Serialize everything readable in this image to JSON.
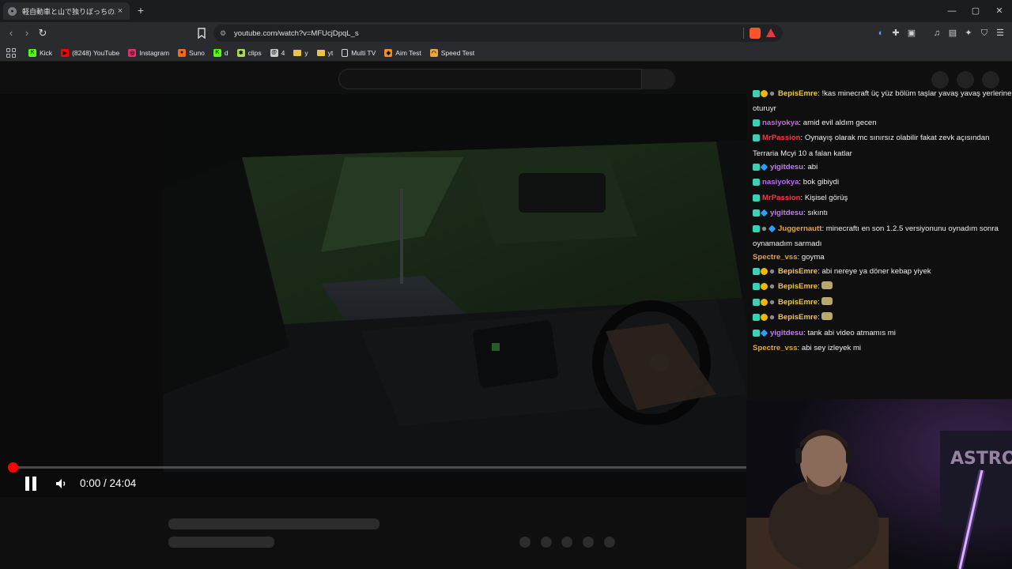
{
  "browser": {
    "tab": {
      "title": "軽自動車と山で独りぼっちの車中泊",
      "close": "×"
    },
    "new_tab": "+",
    "window_controls": {
      "minimize": "—",
      "maximize": "▢",
      "close": "✕"
    },
    "nav": {
      "back": "‹",
      "forward": "›",
      "reload": "↻"
    },
    "url": "youtube.com/watch?v=MFUcjDpqL_s",
    "bookmarks": [
      {
        "label": "Kick",
        "icon": "kick-icon",
        "color": "#53fc18",
        "glyph": "K"
      },
      {
        "label": "(8248) YouTube",
        "icon": "youtube-icon",
        "color": "#ff0000",
        "glyph": "▶"
      },
      {
        "label": "Instagram",
        "icon": "instagram-icon",
        "color": "#e1306c",
        "glyph": "◎"
      },
      {
        "label": "Suno",
        "icon": "suno-icon",
        "color": "#f26b1d",
        "glyph": "●"
      },
      {
        "label": "d",
        "icon": "kick-icon",
        "color": "#53fc18",
        "glyph": "K"
      },
      {
        "label": "clips",
        "icon": "clips-icon",
        "color": "#a8e04a",
        "glyph": "✱"
      },
      {
        "label": "4",
        "icon": "at-icon",
        "color": "#cccccc",
        "glyph": "@"
      },
      {
        "label": "y",
        "icon": "folder-icon",
        "color": "#e8c547",
        "glyph": ""
      },
      {
        "label": "yt",
        "icon": "folder-icon",
        "color": "#e8c547",
        "glyph": ""
      },
      {
        "label": "Multi TV",
        "icon": "document-icon",
        "color": "#dddddd",
        "glyph": ""
      },
      {
        "label": "Aim Test",
        "icon": "fox-icon",
        "color": "#f28c28",
        "glyph": "◆"
      },
      {
        "label": "Speed Test",
        "icon": "speed-icon",
        "color": "#f2a33a",
        "glyph": "◠"
      }
    ]
  },
  "player": {
    "time": "0:00 / 24:04",
    "progress": 0.0
  },
  "chat": [
    {
      "badges": [
        "teal",
        "gold",
        "sub"
      ],
      "user": "BepisEmre",
      "color": "#f5c542",
      "text": "!kas minecraft üç yüz bölüm taşlar yavaş yavaş yerlerine oturuyr",
      "emotes": 0,
      "wrap": true
    },
    {
      "badges": [
        "teal"
      ],
      "user": "nasiyokya",
      "color": "#c266ff",
      "text": "amid evil aldım gecen",
      "emotes": 0
    },
    {
      "badges": [
        "teal"
      ],
      "user": "MrPassion",
      "color": "#ff3344",
      "text": "Oynayış olarak mc sınırsız olabilir fakat zevk açısından Terraria Mcyi 10 a falan katlar",
      "emotes": 0,
      "wrap": true
    },
    {
      "badges": [
        "teal",
        "gem"
      ],
      "user": "yigitdesu",
      "color": "#c07cff",
      "text": "abi",
      "emotes": 0
    },
    {
      "badges": [
        "teal"
      ],
      "user": "nasiyokya",
      "color": "#c266ff",
      "text": "bok gibiydi",
      "emotes": 0
    },
    {
      "badges": [
        "teal"
      ],
      "user": "MrPassion",
      "color": "#ff3344",
      "text": "Kişisel görüş",
      "emotes": 0
    },
    {
      "badges": [
        "teal",
        "gem"
      ],
      "user": "yigitdesu",
      "color": "#c07cff",
      "text": "sıkıntı",
      "emotes": 0
    },
    {
      "badges": [
        "teal",
        "sub",
        "gem"
      ],
      "user": "Juggernautt",
      "color": "#f0a030",
      "text": "minecraftı en son 1.2.5 versiyonunu oynadım sonra oynamadım sarmadı",
      "emotes": 0,
      "wrap": true
    },
    {
      "badges": [],
      "user": "Spectre_vss",
      "color": "#e8a23a",
      "text": "goyma",
      "emotes": 0
    },
    {
      "badges": [
        "teal",
        "gold",
        "sub"
      ],
      "user": "BepisEmre",
      "color": "#f5c542",
      "text": "abi nereye ya döner kebap yiyek",
      "emotes": 0
    },
    {
      "badges": [
        "teal",
        "gold",
        "sub"
      ],
      "user": "BepisEmre",
      "color": "#f5c542",
      "text": "",
      "emotes": 1
    },
    {
      "badges": [
        "teal",
        "gold",
        "sub"
      ],
      "user": "BepisEmre",
      "color": "#f5c542",
      "text": "",
      "emotes": 1
    },
    {
      "badges": [
        "teal",
        "gold",
        "sub"
      ],
      "user": "BepisEmre",
      "color": "#f5c542",
      "text": "",
      "emotes": 1
    },
    {
      "badges": [
        "teal",
        "gem"
      ],
      "user": "yigitdesu",
      "color": "#c07cff",
      "text": "tank abi video atmamıs mi",
      "emotes": 0
    },
    {
      "badges": [],
      "user": "Spectre_vss",
      "color": "#e8a23a",
      "text": "abi sey izleyek mi",
      "emotes": 0
    }
  ],
  "webcam": {
    "poster_text": "ASTRO WORLD"
  }
}
